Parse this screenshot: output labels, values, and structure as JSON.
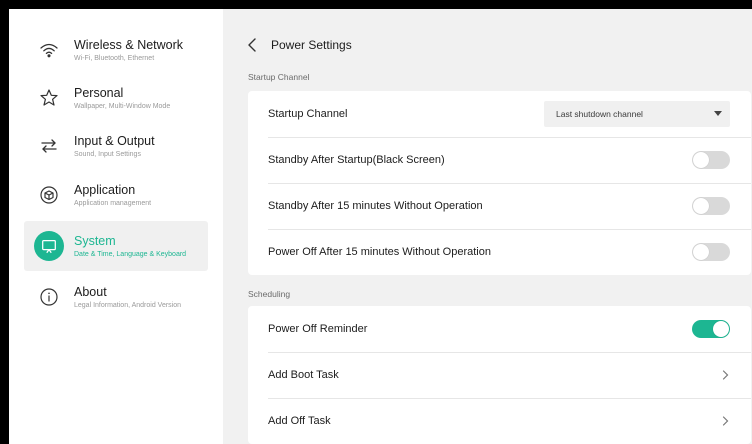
{
  "colors": {
    "accent": "#1db692",
    "background": "#f1f1f1",
    "toggle_off": "#d9d9d9"
  },
  "sidebar": {
    "items": [
      {
        "title": "Wireless & Network",
        "subtitle": "Wi-Fi, Bluetooth, Ethernet",
        "icon": "wifi-icon",
        "active": false
      },
      {
        "title": "Personal",
        "subtitle": "Wallpaper, Multi-Window Mode",
        "icon": "star-icon",
        "active": false
      },
      {
        "title": "Input & Output",
        "subtitle": "Sound, Input Settings",
        "icon": "swap-arrows-icon",
        "active": false
      },
      {
        "title": "Application",
        "subtitle": "Application management",
        "icon": "cube-icon",
        "active": false
      },
      {
        "title": "System",
        "subtitle": "Date & Time, Language & Keyboard",
        "icon": "monitor-icon",
        "active": true
      },
      {
        "title": "About",
        "subtitle": "Legal Information, Android Version",
        "icon": "info-icon",
        "active": false
      }
    ]
  },
  "header": {
    "title": "Power Settings",
    "back_icon": "back-chevron-icon"
  },
  "sections": {
    "startup": {
      "label": "Startup Channel",
      "rows": [
        {
          "label": "Startup Channel",
          "control": "select",
          "value": "Last shutdown channel"
        },
        {
          "label": "Standby After Startup(Black Screen)",
          "control": "toggle",
          "on": false
        },
        {
          "label": "Standby After 15 minutes Without Operation",
          "control": "toggle",
          "on": false
        },
        {
          "label": "Power Off After 15 minutes Without Operation",
          "control": "toggle",
          "on": false
        }
      ]
    },
    "scheduling": {
      "label": "Scheduling",
      "rows": [
        {
          "label": "Power Off Reminder",
          "control": "toggle",
          "on": true
        },
        {
          "label": "Add Boot Task",
          "control": "chevron"
        },
        {
          "label": "Add Off Task",
          "control": "chevron"
        }
      ]
    }
  }
}
